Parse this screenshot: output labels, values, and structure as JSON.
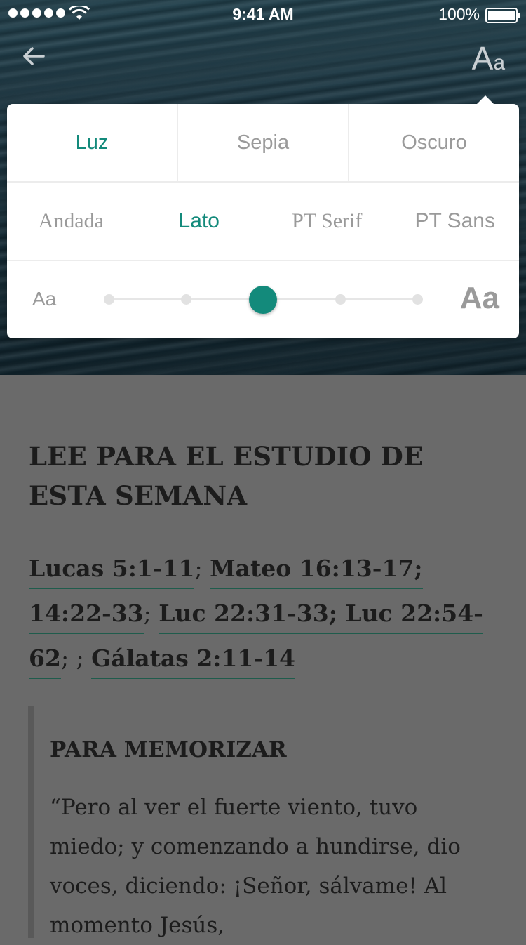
{
  "status_bar": {
    "time": "9:41 AM",
    "battery": "100%"
  },
  "header": {
    "back_icon": "arrow-left-icon",
    "font_toggle_big": "A",
    "font_toggle_small": "a"
  },
  "settings": {
    "themes": [
      {
        "label": "Luz",
        "active": true
      },
      {
        "label": "Sepia",
        "active": false
      },
      {
        "label": "Oscuro",
        "active": false
      }
    ],
    "fonts": [
      {
        "label": "Andada",
        "active": false
      },
      {
        "label": "Lato",
        "active": true
      },
      {
        "label": "PT Serif",
        "active": false
      },
      {
        "label": "PT Sans",
        "active": false
      }
    ],
    "size": {
      "small_label": "Aa",
      "large_label": "Aa",
      "steps": 5,
      "selected_index": 2
    },
    "accent": "#138a7b"
  },
  "reading": {
    "heading": "LEE PARA EL ESTUDIO DE ESTA SEMANA",
    "refs": [
      {
        "text": "Lucas 5:1-11",
        "link": true
      },
      {
        "text": "; ",
        "link": false
      },
      {
        "text": "Mateo 16:13-17; 14:22-33",
        "link": true
      },
      {
        "text": "; ",
        "link": false
      },
      {
        "text": "Luc 22:31-33; Luc 22:54-62",
        "link": true
      },
      {
        "text": "; ; ",
        "link": false
      },
      {
        "text": "Gálatas 2:11-14",
        "link": true
      }
    ],
    "memo_title": "PARA MEMORIZAR",
    "memo_text": "“Pero al ver el fuerte viento, tuvo miedo; y comenzando a hundirse, dio voces, diciendo: ¡Señor, sálvame! Al momento Jesús,"
  }
}
